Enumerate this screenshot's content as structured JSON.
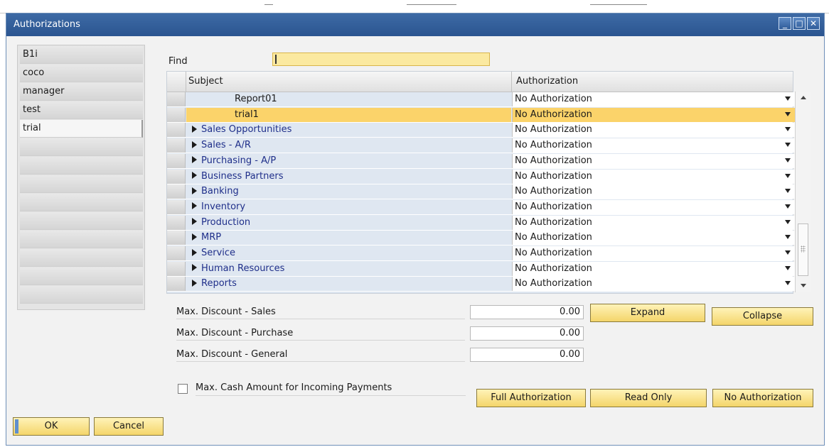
{
  "window": {
    "title": "Authorizations"
  },
  "users": [
    "B1i",
    "coco",
    "manager",
    "test",
    "trial",
    "",
    "",
    "",
    "",
    "",
    "",
    "",
    "",
    ""
  ],
  "find": {
    "label": "Find",
    "value": ""
  },
  "grid": {
    "columns": [
      "Subject",
      "Authorization"
    ],
    "rows": [
      {
        "subject": "Report01",
        "authorization": "No Authorization",
        "child": true,
        "selected": false
      },
      {
        "subject": "trial1",
        "authorization": "No Authorization",
        "child": true,
        "selected": true
      },
      {
        "subject": "Sales Opportunities",
        "authorization": "No Authorization",
        "child": false,
        "selected": false
      },
      {
        "subject": "Sales - A/R",
        "authorization": "No Authorization",
        "child": false,
        "selected": false
      },
      {
        "subject": "Purchasing - A/P",
        "authorization": "No Authorization",
        "child": false,
        "selected": false
      },
      {
        "subject": "Business Partners",
        "authorization": "No Authorization",
        "child": false,
        "selected": false
      },
      {
        "subject": "Banking",
        "authorization": "No Authorization",
        "child": false,
        "selected": false
      },
      {
        "subject": "Inventory",
        "authorization": "No Authorization",
        "child": false,
        "selected": false
      },
      {
        "subject": "Production",
        "authorization": "No Authorization",
        "child": false,
        "selected": false
      },
      {
        "subject": "MRP",
        "authorization": "No Authorization",
        "child": false,
        "selected": false
      },
      {
        "subject": "Service",
        "authorization": "No Authorization",
        "child": false,
        "selected": false
      },
      {
        "subject": "Human Resources",
        "authorization": "No Authorization",
        "child": false,
        "selected": false
      },
      {
        "subject": "Reports",
        "authorization": "No Authorization",
        "child": false,
        "selected": false
      }
    ]
  },
  "fields": {
    "max_discount_sales": {
      "label": "Max. Discount - Sales",
      "value": "0.00"
    },
    "max_discount_purchase": {
      "label": "Max. Discount - Purchase",
      "value": "0.00"
    },
    "max_discount_general": {
      "label": "Max. Discount - General",
      "value": "0.00"
    },
    "max_cash": {
      "label": "Max. Cash Amount for Incoming Payments",
      "checked": false
    }
  },
  "buttons": {
    "expand": "Expand",
    "collapse": "Collapse",
    "full_authorization": "Full Authorization",
    "read_only": "Read Only",
    "no_authorization": "No Authorization",
    "ok": "OK",
    "cancel": "Cancel"
  },
  "colors": {
    "titlebar": "#2b5590",
    "selected_row": "#fbd36a",
    "find_field": "#fbe9a0",
    "button": "#f4d56a",
    "subject_text": "#1f2f8a"
  }
}
